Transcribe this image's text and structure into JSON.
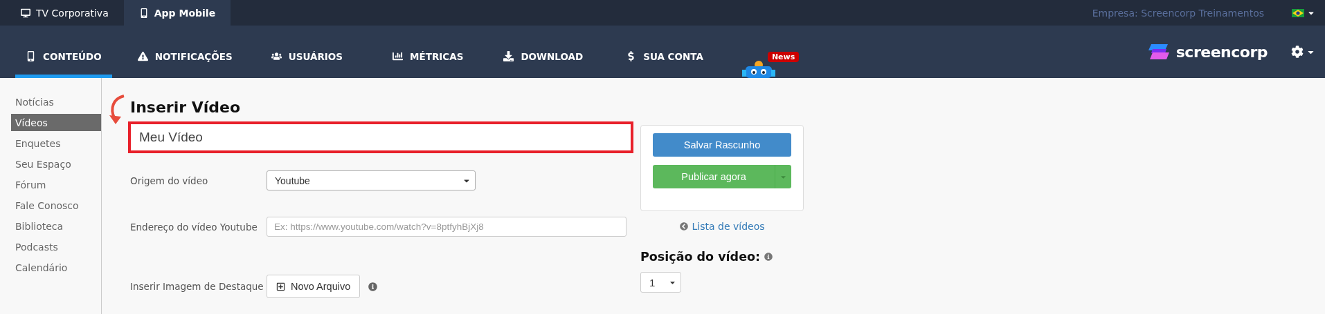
{
  "top_tabs": [
    {
      "label": "TV Corporativa",
      "selected": false
    },
    {
      "label": "App Mobile",
      "selected": true
    }
  ],
  "company": "Empresa: Screencorp Treinamentos",
  "nav": [
    {
      "label": "CONTEÚDO",
      "selected": true
    },
    {
      "label": "NOTIFICAÇÕES",
      "selected": false
    },
    {
      "label": "USUÁRIOS",
      "selected": false
    },
    {
      "label": "MÉTRICAS",
      "selected": false
    },
    {
      "label": "DOWNLOAD",
      "selected": false
    },
    {
      "label": "SUA CONTA",
      "selected": false
    }
  ],
  "news_badge": "News",
  "brand": "screencorp",
  "sidebar": [
    {
      "label": "Notícias",
      "selected": false
    },
    {
      "label": "Vídeos",
      "selected": true
    },
    {
      "label": "Enquetes",
      "selected": false
    },
    {
      "label": "Seu Espaço",
      "selected": false
    },
    {
      "label": "Fórum",
      "selected": false
    },
    {
      "label": "Fale Conosco",
      "selected": false
    },
    {
      "label": "Biblioteca",
      "selected": false
    },
    {
      "label": "Podcasts",
      "selected": false
    },
    {
      "label": "Calendário",
      "selected": false
    }
  ],
  "page_title": "Inserir Vídeo",
  "title_field": {
    "value": "Meu Vídeo"
  },
  "fields": [
    {
      "kind": "select",
      "label": "Origem do vídeo",
      "value": "Youtube"
    },
    {
      "kind": "text",
      "label": "Endereço do vídeo Youtube",
      "placeholder": "Ex: https://www.youtube.com/watch?v=8ptfyhBjXj8"
    },
    {
      "kind": "file",
      "label": "Inserir Imagem de Destaque",
      "button": "Novo Arquivo"
    }
  ],
  "actions": {
    "save": "Salvar Rascunho",
    "publish": "Publicar agora"
  },
  "back_link": "Lista de vídeos",
  "position": {
    "label": "Posição do vídeo:",
    "value": "1"
  }
}
